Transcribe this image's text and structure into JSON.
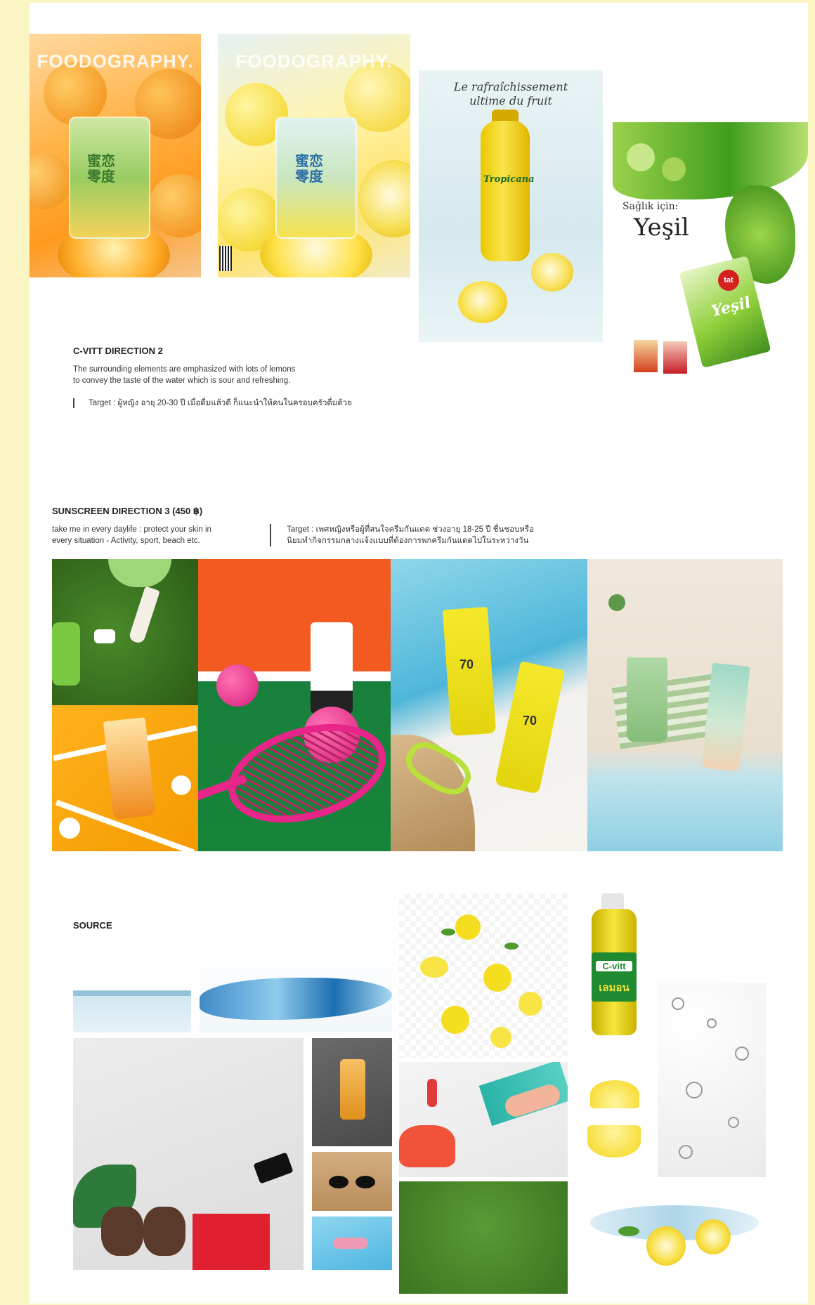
{
  "section_cvitt": {
    "title": "C-VITT DIRECTION 2",
    "description_line1": "The surrounding elements are emphasized with lots of lemons",
    "description_line2": "to convey the taste of the water which is sour and refreshing.",
    "target": "Target : ผู้หญิง อายุ 20-30 ปี เมื่อดื่มแล้วดี ก็แนะนำให้คนในครอบครัวดื่มด้วย"
  },
  "covers": {
    "brand": "FOODOGRAPHY.",
    "can_label": "蜜恋零度"
  },
  "tropicana": {
    "headline_line1": "Le rafraîchissement",
    "headline_line2": "ultime du fruit",
    "brand": "Tropicana"
  },
  "yesil": {
    "subtitle": "Sağlık için:",
    "title": "Yeşil",
    "badge": "tat",
    "box_text": "Yeşil"
  },
  "section_sunscreen": {
    "title": "SUNSCREEN DIRECTION 3 (450 ฿)",
    "description_line1": "take me in every daylife : protect your skin in",
    "description_line2": "every situation - Activity, sport, beach etc.",
    "target_line1": "Target : เพศหญิงหรือผู้ที่สนใจครีมกันแดด ช่วงอายุ 18-25 ปี ชื่นชอบหรือ",
    "target_line2": "นิยมทำกิจกรรมกลางแจ้งแบบที่ต้องการพกครีมกันแดดไปในระหว่างวัน",
    "spf": "70"
  },
  "section_source": {
    "title": "SOURCE",
    "cvitt_name": "C-vitt",
    "cvitt_thai": "เลมอน"
  }
}
